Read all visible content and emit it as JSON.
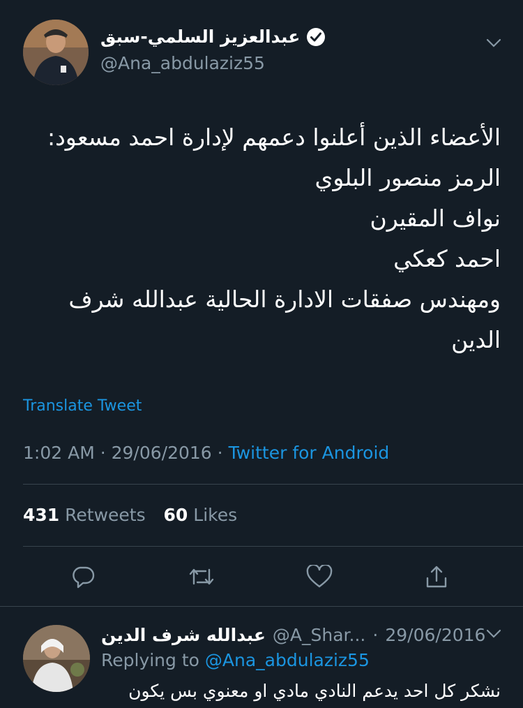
{
  "tweet": {
    "author_name": "عبدالعزيز السلمي-سبق",
    "author_handle": "@Ana_abdulaziz55",
    "lines": [
      "الأعضاء الذين أعلنوا دعمهم لإدارة احمد مسعود:",
      "الرمز منصور البلوي",
      "نواف المقيرن",
      "احمد كعكي",
      "ومهندس صفقات الادارة الحالية عبدالله شرف",
      "الدين"
    ],
    "translate_label": "Translate Tweet",
    "time": "1:02 AM",
    "date": "29/06/2016",
    "source": "Twitter for Android",
    "separator": "·",
    "retweets_count": "431",
    "retweets_label": "Retweets",
    "likes_count": "60",
    "likes_label": "Likes"
  },
  "actions": {
    "reply_icon": "reply-icon",
    "retweet_icon": "retweet-icon",
    "like_icon": "heart-icon",
    "share_icon": "share-icon"
  },
  "reply": {
    "author_name": "عبدالله شرف الدين",
    "author_handle": "@A_Shar...",
    "date": "29/06/2016",
    "separator": "·",
    "replying_to_label": "Replying to",
    "replying_to_handle": "@Ana_abdulaziz55",
    "text": "نشكر كل احد يدعم النادي مادي او معنوي بس يكون"
  },
  "colors": {
    "background": "#141d26",
    "link": "#1b95e0",
    "muted": "#8899a6",
    "divider": "#38444d"
  }
}
